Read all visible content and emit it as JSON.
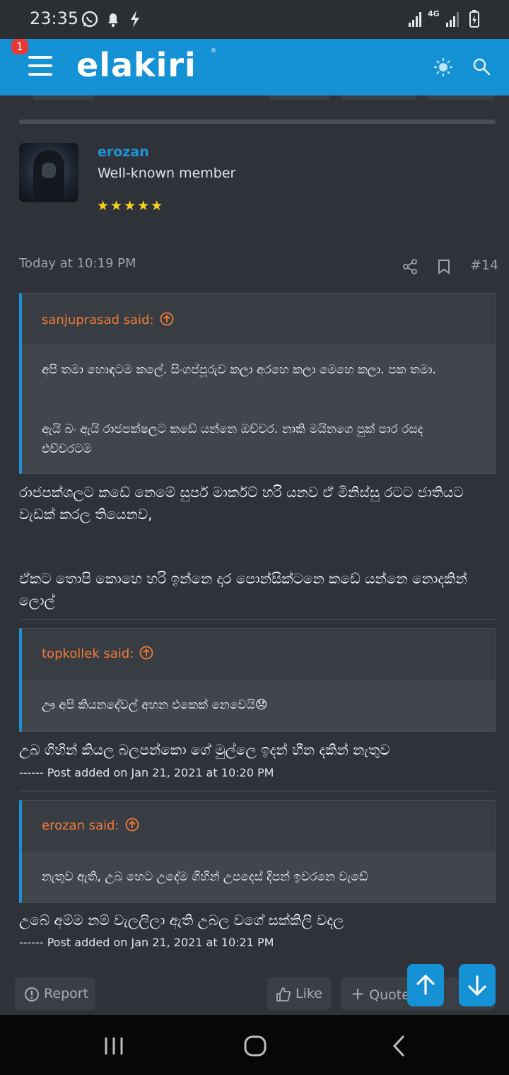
{
  "status_bar": {
    "time": "23:35",
    "icons": [
      "whatsapp-icon",
      "notification-bell-icon",
      "lightning-icon",
      "signal-icon",
      "4g-icon",
      "signal-icon",
      "battery-charging-icon"
    ],
    "network_label": "4G"
  },
  "header": {
    "logo": "elakiri",
    "logo_tm": "®",
    "notification_count": "1",
    "accent": "#1591d6"
  },
  "post": {
    "author": "erozan",
    "user_title": "Well-known member",
    "stars": "★★★★★",
    "date": "Today at 10:19 PM",
    "number": "#14",
    "quotes": [
      {
        "author": "sanjuprasad said:",
        "paragraphs": [
          "අපි තමා හොඳටම කලේ. සිංගප්පූරුව කලා අරහෙ කලා මෙහෙ කලා. පක තමා.",
          "ඇයි බං ඇයි රාජපක්ෂලට කඩේ යන්නෙ ඔච්චර. නාකි මයිනගෙ පුක් පාර රසද එච්චරටම"
        ]
      },
      {
        "author": "topkollek said:",
        "paragraphs": [
          "ඌ අපි කියනදේවල් අහන එකෙක් නෙවෙයි😞"
        ]
      },
      {
        "author": "erozan said:",
        "paragraphs": [
          "නැතුව ඇති, උබ හෙට උදේම ගිහින් උපදෙස් දිපන් ඉවරනෙ වැඩේ"
        ]
      }
    ],
    "replies": [
      "රාජපක්ශලට කඩේ නෙමේ සුපර් මාර්කට් හරි යනව ඒ මිනිස්සු රටට ජාතියට වැඩක් කරල තියෙනව,",
      "ඒකට තොපි කොහෙ හරි ඉන්නෙ දාර පොන්සික්ටනෙ කඩේ යන්නෙ නොදකින් ලොල්",
      "උබ ගිහින් කියල බලපන්කො ගේ මුල්ලෙ ඉදන් හීන දකින් නැතුව",
      "උබේ අම්ම නම් වැලලිලා ඇති උබල වගේ සක්කිලි වදල"
    ],
    "post_added_1": "------ Post added on Jan 21, 2021 at 10:20 PM",
    "post_added_2": "------ Post added on Jan 21, 2021 at 10:21 PM"
  },
  "actions": {
    "report": "Report",
    "like": "Like",
    "quote": "Quote"
  }
}
